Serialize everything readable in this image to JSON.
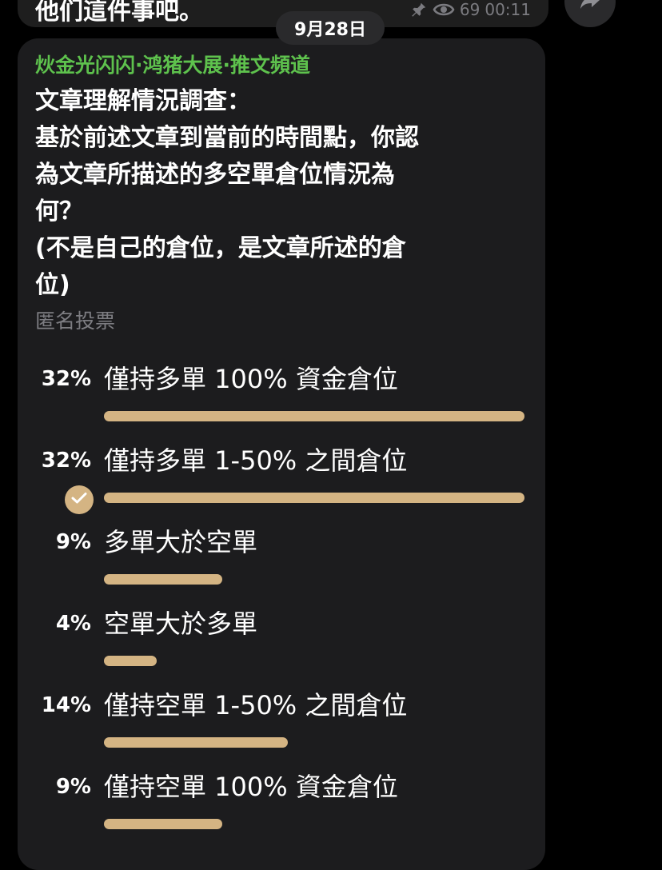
{
  "previous_message": {
    "text": "他们這件事吧。",
    "views": "69",
    "time": "00:11"
  },
  "date_separator": "9月28日",
  "poll": {
    "channel_name": "炏金光闪闪·鸿猪大展·推文頻道",
    "question_lines": [
      "文章理解情況調查：",
      "基於前述文章到當前的時間點，你認",
      "為文章所描述的多空單倉位情況為",
      "何？",
      "(不是自己的倉位，是文章所述的倉",
      "位)"
    ],
    "poll_type": "匿名投票",
    "options": [
      {
        "percent": "32%",
        "label": "僅持多單 100% 資金倉位",
        "fraction": 0.32,
        "selected": false
      },
      {
        "percent": "32%",
        "label": "僅持多單 1-50% 之間倉位",
        "fraction": 0.32,
        "selected": true
      },
      {
        "percent": "9%",
        "label": "多單大於空單",
        "fraction": 0.09,
        "selected": false
      },
      {
        "percent": "4%",
        "label": "空單大於多單",
        "fraction": 0.04,
        "selected": false
      },
      {
        "percent": "14%",
        "label": "僅持空單 1-50% 之間倉位",
        "fraction": 0.14,
        "selected": false
      },
      {
        "percent": "9%",
        "label": "僅持空單 100% 資金倉位",
        "fraction": 0.09,
        "selected": false
      }
    ]
  },
  "colors": {
    "background": "#000000",
    "bubble": "#1c1c1e",
    "channel_name": "#5ec24d",
    "bar": "#d4b483",
    "muted_text": "#7d7d82",
    "date_pill": "#2a2a2c"
  },
  "icons": {
    "pin": "pin-icon",
    "views": "eye-icon",
    "share": "share-icon",
    "check": "check-icon"
  }
}
